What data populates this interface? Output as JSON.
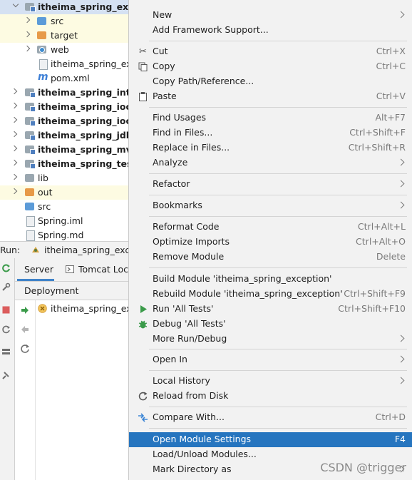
{
  "project_tree": {
    "items": [
      {
        "label": "itheima_spring_exception",
        "bold": true
      },
      {
        "label": "src"
      },
      {
        "label": "target"
      },
      {
        "label": "web"
      },
      {
        "label": "itheima_spring_exception.iml"
      },
      {
        "label": "pom.xml"
      },
      {
        "label": "itheima_spring_interceptor",
        "bold": true
      },
      {
        "label": "itheima_spring_ioc",
        "bold": true
      },
      {
        "label": "itheima_spring_ioc_anno",
        "bold": true
      },
      {
        "label": "itheima_spring_jdbc",
        "bold": true
      },
      {
        "label": "itheima_spring_mvc",
        "bold": true
      },
      {
        "label": "itheima_spring_test",
        "bold": true
      },
      {
        "label": "lib"
      },
      {
        "label": "out"
      },
      {
        "label": "src"
      },
      {
        "label": "Spring.iml"
      },
      {
        "label": "Spring.md"
      }
    ]
  },
  "run_panel": {
    "run_label": "Run:",
    "config_name": "itheima_spring_exception",
    "tabs": {
      "server": "Server",
      "tomcat": "Tomcat Localhost Log"
    },
    "deployment_header": "Deployment",
    "deployment_item": "itheima_spring_exception:war exploded"
  },
  "context_menu": {
    "items": [
      {
        "label": "New",
        "shortcut": "",
        "submenu": true
      },
      {
        "label": "Add Framework Support...",
        "shortcut": ""
      },
      {
        "label": "Cut",
        "shortcut": "Ctrl+X",
        "icon": "scissors-icon"
      },
      {
        "label": "Copy",
        "shortcut": "Ctrl+C",
        "icon": "copy-icon"
      },
      {
        "label": "Copy Path/Reference...",
        "shortcut": ""
      },
      {
        "label": "Paste",
        "shortcut": "Ctrl+V",
        "icon": "paste-icon"
      },
      {
        "label": "Find Usages",
        "shortcut": "Alt+F7"
      },
      {
        "label": "Find in Files...",
        "shortcut": "Ctrl+Shift+F"
      },
      {
        "label": "Replace in Files...",
        "shortcut": "Ctrl+Shift+R"
      },
      {
        "label": "Analyze",
        "shortcut": "",
        "submenu": true
      },
      {
        "label": "Refactor",
        "shortcut": "",
        "submenu": true
      },
      {
        "label": "Bookmarks",
        "shortcut": "",
        "submenu": true
      },
      {
        "label": "Reformat Code",
        "shortcut": "Ctrl+Alt+L"
      },
      {
        "label": "Optimize Imports",
        "shortcut": "Ctrl+Alt+O"
      },
      {
        "label": "Remove Module",
        "shortcut": "Delete"
      },
      {
        "label": "Build Module 'itheima_spring_exception'",
        "shortcut": ""
      },
      {
        "label": "Rebuild Module 'itheima_spring_exception'",
        "shortcut": "Ctrl+Shift+F9"
      },
      {
        "label": "Run 'All Tests'",
        "shortcut": "Ctrl+Shift+F10",
        "icon": "run-icon"
      },
      {
        "label": "Debug 'All Tests'",
        "shortcut": "",
        "icon": "debug-icon"
      },
      {
        "label": "More Run/Debug",
        "shortcut": "",
        "submenu": true
      },
      {
        "label": "Open In",
        "shortcut": "",
        "submenu": true
      },
      {
        "label": "Local History",
        "shortcut": "",
        "submenu": true
      },
      {
        "label": "Reload from Disk",
        "shortcut": "",
        "icon": "reload-icon"
      },
      {
        "label": "Compare With...",
        "shortcut": "Ctrl+D",
        "icon": "compare-icon"
      },
      {
        "label": "Open Module Settings",
        "shortcut": "F4",
        "highlighted": true
      },
      {
        "label": "Load/Unload Modules...",
        "shortcut": ""
      },
      {
        "label": "Mark Directory as",
        "shortcut": "",
        "submenu": true
      }
    ]
  },
  "watermark": "CSDN @trigger",
  "colors": {
    "highlight": "#2675bf",
    "menu_bg": "#f2f2f2",
    "selection": "#d5e1f2"
  }
}
